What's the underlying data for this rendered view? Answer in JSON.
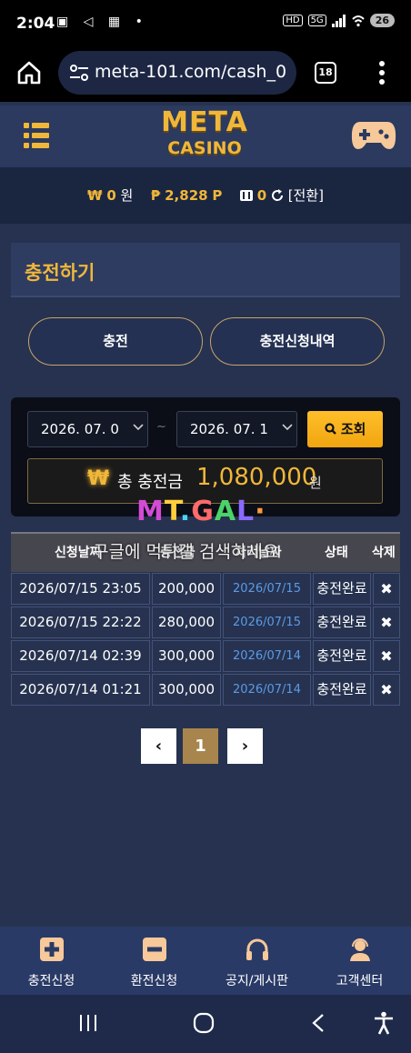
{
  "status_bar": {
    "time": "2:04",
    "left_icons": "▣ ◁ ▦ •",
    "hd_label": "HD",
    "net_label": "5G",
    "battery": "26"
  },
  "browser": {
    "url": "meta-101.com/cash_0",
    "tab_count": "18"
  },
  "header": {
    "logo_line1": "META",
    "logo_line2": "CASINO"
  },
  "balance": {
    "won_symbol": "₩",
    "won_value": "0",
    "won_unit": "원",
    "point_symbol": "₱",
    "point_value": "2,828",
    "point_unit": "P",
    "chip_value": "0",
    "convert_label": "[전환]"
  },
  "page": {
    "title": "충전하기"
  },
  "tabs": {
    "charge": "충전",
    "history": "충전신청내역"
  },
  "search": {
    "date_from": "2026. 07. 0",
    "date_to": "2026. 07. 1",
    "tilde": "~",
    "search_label": "조회",
    "total_symbol": "₩",
    "total_label": "총 충전금",
    "total_amount": "1,080,000",
    "total_unit": "원"
  },
  "watermark": {
    "logo": [
      "M",
      "T",
      ".",
      "G",
      "A",
      "L",
      "·"
    ],
    "text": "구글에 먹튀갤 검색하세요"
  },
  "table": {
    "headers": [
      "신청날짜",
      "충전금",
      "처리날짜",
      "상태",
      "삭제"
    ],
    "rows": [
      {
        "date": "2026/07/15 23:05",
        "amount": "200,000",
        "processed": "2026/07/15",
        "status": "충전완료",
        "delete": "✖"
      },
      {
        "date": "2026/07/15 22:22",
        "amount": "280,000",
        "processed": "2026/07/15",
        "status": "충전완료",
        "delete": "✖"
      },
      {
        "date": "2026/07/14 02:39",
        "amount": "300,000",
        "processed": "2026/07/14",
        "status": "충전완료",
        "delete": "✖"
      },
      {
        "date": "2026/07/14 01:21",
        "amount": "300,000",
        "processed": "2026/07/14",
        "status": "충전완료",
        "delete": "✖"
      }
    ]
  },
  "pagination": {
    "prev": "‹",
    "current": "1",
    "next": "›"
  },
  "bottom_nav": {
    "items": [
      {
        "label": "충전신청",
        "icon": "plus-box-icon"
      },
      {
        "label": "환전신청",
        "icon": "minus-box-icon"
      },
      {
        "label": "공지/게시판",
        "icon": "headphones-icon"
      },
      {
        "label": "고객센터",
        "icon": "support-agent-icon"
      }
    ]
  },
  "colors": {
    "accent_gold": "#f0b73a",
    "page_bg": "#26324f",
    "link_blue": "#5b9be8",
    "search_yellow": "#f0a510"
  }
}
